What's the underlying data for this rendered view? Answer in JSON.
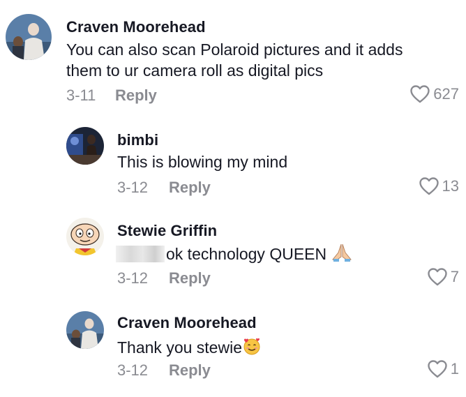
{
  "comments": [
    {
      "author": "Craven Moorehead",
      "text_line1": "You can also scan Polaroid pictures and it adds",
      "text_line2": "them to ur camera roll as digital pics",
      "date": "3-11",
      "reply_label": "Reply",
      "likes": "627",
      "avatar": "photo-avatar"
    },
    {
      "author": "bimbi",
      "text": "This is blowing my mind",
      "date": "3-12",
      "reply_label": "Reply",
      "likes": "13",
      "avatar": "photo-avatar"
    },
    {
      "author": "Stewie Griffin",
      "text": "ok technology QUEEN",
      "emoji": "folded-hands-emoji",
      "date": "3-12",
      "reply_label": "Reply",
      "likes": "7",
      "avatar": "cartoon-avatar"
    },
    {
      "author": "Craven Moorehead",
      "text": "Thank you stewie",
      "emoji": "smiling-face-with-hearts-emoji",
      "date": "3-12",
      "reply_label": "Reply",
      "likes": "1",
      "avatar": "photo-avatar"
    }
  ],
  "icons": {
    "like": "heart-outline-icon"
  },
  "colors": {
    "text_primary": "#161823",
    "text_secondary": "#8a8b91",
    "background": "#ffffff"
  }
}
